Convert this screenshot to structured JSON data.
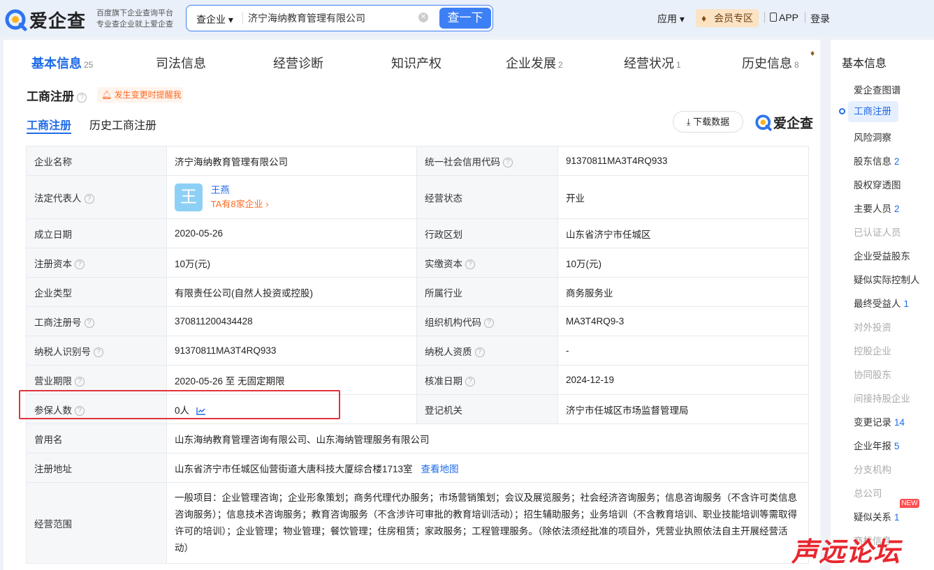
{
  "header": {
    "logo_text": "爱企查",
    "slogan_line1": "百度旗下企业查询平台",
    "slogan_line2": "专业查企业就上爱企查",
    "search_type": "查企业 ▾",
    "search_value": "济宁海纳教育管理有限公司",
    "search_button": "查一下",
    "nav_app_menu": "应用 ▾",
    "nav_vip": "会员专区",
    "nav_app_download": "APP",
    "nav_login": "登录"
  },
  "main_tabs": [
    {
      "label": "基本信息",
      "count": "25"
    },
    {
      "label": "司法信息",
      "count": ""
    },
    {
      "label": "经营诊断",
      "count": ""
    },
    {
      "label": "知识产权",
      "count": ""
    },
    {
      "label": "企业发展",
      "count": "2"
    },
    {
      "label": "经营状况",
      "count": "1"
    },
    {
      "label": "历史信息",
      "count": "8"
    }
  ],
  "section": {
    "title": "工商注册",
    "alert": "发生变更时提醒我",
    "subtab_current": "工商注册",
    "subtab_history": "历史工商注册",
    "download_button": "下载数据",
    "brand": "爱企查"
  },
  "registration": {
    "company_name_label": "企业名称",
    "company_name": "济宁海纳教育管理有限公司",
    "credit_code_label": "统一社会信用代码",
    "credit_code": "91370811MA3T4RQ933",
    "legal_rep_label": "法定代表人",
    "legal_rep_avatar": "王",
    "legal_rep_name": "王燕",
    "legal_rep_companies": "TA有8家企业 ›",
    "status_label": "经营状态",
    "status": "开业",
    "founded_label": "成立日期",
    "founded": "2020-05-26",
    "district_label": "行政区划",
    "district": "山东省济宁市任城区",
    "reg_capital_label": "注册资本",
    "reg_capital": "10万(元)",
    "paid_capital_label": "实缴资本",
    "paid_capital": "10万(元)",
    "company_type_label": "企业类型",
    "company_type": "有限责任公司(自然人投资或控股)",
    "industry_label": "所属行业",
    "industry": "商务服务业",
    "reg_no_label": "工商注册号",
    "reg_no": "370811200434428",
    "org_code_label": "组织机构代码",
    "org_code": "MA3T4RQ9-3",
    "taxpayer_id_label": "纳税人识别号",
    "taxpayer_id": "91370811MA3T4RQ933",
    "taxpayer_qual_label": "纳税人资质",
    "taxpayer_qual": "-",
    "term_label": "营业期限",
    "term": "2020-05-26 至 无固定期限",
    "approval_date_label": "核准日期",
    "approval_date": "2024-12-19",
    "insured_label": "参保人数",
    "insured": "0人",
    "authority_label": "登记机关",
    "authority": "济宁市任城区市场监督管理局",
    "former_names_label": "曾用名",
    "former_names": "山东海纳教育管理咨询有限公司、山东海纳管理服务有限公司",
    "address_label": "注册地址",
    "address": "山东省济宁市任城区仙营街道大唐科技大厦综合楼1713室",
    "map_link": "查看地图",
    "scope_label": "经营范围",
    "scope": "一般项目：企业管理咨询；企业形象策划；商务代理代办服务；市场营销策划；会议及展览服务；社会经济咨询服务；信息咨询服务（不含许可类信息咨询服务）；信息技术咨询服务；教育咨询服务（不含涉许可审批的教育培训活动）；招生辅助服务；业务培训（不含教育培训、职业技能培训等需取得许可的培训）；企业管理；物业管理；餐饮管理；住房租赁；家政服务；工程管理服务。（除依法须经批准的项目外，凭营业执照依法自主开展经营活动）"
  },
  "sidebar": {
    "title": "基本信息",
    "items": [
      {
        "label": "爱企查图谱",
        "count": "",
        "disabled": false
      },
      {
        "label": "工商注册",
        "count": "",
        "disabled": false
      },
      {
        "label": "风险洞察",
        "count": "",
        "disabled": false
      },
      {
        "label": "股东信息",
        "count": "2",
        "disabled": false
      },
      {
        "label": "股权穿透图",
        "count": "",
        "disabled": false
      },
      {
        "label": "主要人员",
        "count": "2",
        "disabled": false
      },
      {
        "label": "已认证人员",
        "count": "",
        "disabled": true
      },
      {
        "label": "企业受益股东",
        "count": "",
        "disabled": false
      },
      {
        "label": "疑似实际控制人",
        "count": "",
        "disabled": false
      },
      {
        "label": "最终受益人",
        "count": "1",
        "disabled": false
      },
      {
        "label": "对外投资",
        "count": "",
        "disabled": true
      },
      {
        "label": "控股企业",
        "count": "",
        "disabled": true
      },
      {
        "label": "协同股东",
        "count": "",
        "disabled": true
      },
      {
        "label": "间接持股企业",
        "count": "",
        "disabled": true
      },
      {
        "label": "变更记录",
        "count": "14",
        "disabled": false
      },
      {
        "label": "企业年报",
        "count": "5",
        "disabled": false
      },
      {
        "label": "分支机构",
        "count": "",
        "disabled": true
      },
      {
        "label": "总公司",
        "count": "",
        "disabled": true
      },
      {
        "label": "疑似关系",
        "count": "1",
        "disabled": false
      },
      {
        "label": "商标信息",
        "count": "",
        "disabled": true
      }
    ],
    "new_badge": "NEW"
  },
  "watermark": "声远论坛"
}
